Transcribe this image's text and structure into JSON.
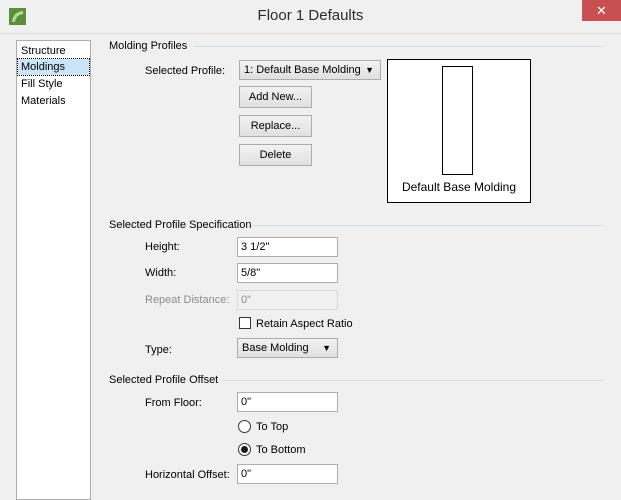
{
  "window": {
    "title": "Floor 1 Defaults",
    "close_glyph": "✕"
  },
  "sidebar": {
    "items": [
      {
        "label": "Structure"
      },
      {
        "label": "Moldings"
      },
      {
        "label": "Fill Style"
      },
      {
        "label": "Materials"
      }
    ],
    "selected": "Moldings"
  },
  "molding_profiles": {
    "section_title": "Molding Profiles",
    "selected_profile_label": "Selected Profile:",
    "selected_profile_value": "1:  Default Base Molding",
    "add_new_label": "Add New...",
    "replace_label": "Replace...",
    "delete_label": "Delete",
    "preview_label": "Default Base Molding"
  },
  "spec": {
    "section_title": "Selected Profile Specification",
    "height_label": "Height:",
    "height_value": "3 1/2\"",
    "width_label": "Width:",
    "width_value": "5/8\"",
    "repeat_label": "Repeat Distance:",
    "repeat_value": "0\"",
    "aspect_label": "Retain Aspect Ratio",
    "aspect_checked": false,
    "type_label": "Type:",
    "type_value": "Base Molding"
  },
  "offset": {
    "section_title": "Selected Profile Offset",
    "from_floor_label": "From Floor:",
    "from_floor_value": "0\"",
    "to_top_label": "To Top",
    "to_bottom_label": "To Bottom",
    "selected_radio": "To Bottom",
    "horizontal_label": "Horizontal Offset:",
    "horizontal_value": "0\""
  },
  "colors": {
    "close_button": "#c75050",
    "selection": "#cce4f7",
    "app_icon": "#5a8f3c"
  },
  "icons": {
    "app": "app-logo-icon",
    "dropdown": "chevron-down-icon",
    "close": "close-icon"
  }
}
